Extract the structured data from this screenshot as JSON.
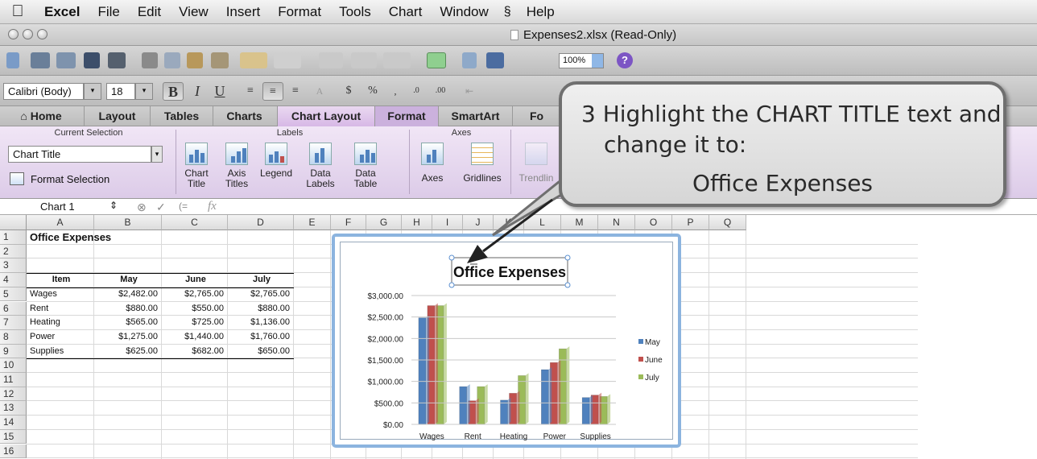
{
  "menubar": {
    "app": "Excel",
    "items": [
      "File",
      "Edit",
      "View",
      "Insert",
      "Format",
      "Tools",
      "Chart",
      "Window",
      "Help"
    ]
  },
  "window": {
    "title": "Expenses2.xlsx  (Read-Only)"
  },
  "toolbar": {
    "zoom": "100%"
  },
  "format_bar": {
    "font": "Calibri (Body)",
    "size": "18"
  },
  "ribbon": {
    "tabs": [
      "Home",
      "Layout",
      "Tables",
      "Charts",
      "Chart Layout",
      "Format",
      "SmartArt",
      "Fo"
    ],
    "active_tab": "Chart Layout",
    "groups": {
      "current_selection": "Current Selection",
      "labels": "Labels",
      "axes": "Axes"
    },
    "current_selection_value": "Chart Title",
    "format_selection": "Format Selection",
    "buttons": {
      "chart_title": [
        "Chart",
        "Title"
      ],
      "axis_titles": [
        "Axis",
        "Titles"
      ],
      "legend": "Legend",
      "data_labels": [
        "Data",
        "Labels"
      ],
      "data_table": [
        "Data",
        "Table"
      ],
      "axes": "Axes",
      "gridlines": "Gridlines",
      "trendline": "Trendlin"
    }
  },
  "formula_bar": {
    "name_box": "Chart 1",
    "fx": "fx"
  },
  "sheet": {
    "columns": [
      "A",
      "B",
      "C",
      "D",
      "E",
      "F",
      "G",
      "H",
      "I",
      "J",
      "K",
      "L",
      "M",
      "N",
      "O",
      "P",
      "Q"
    ],
    "rows": [
      "1",
      "2",
      "3",
      "4",
      "5",
      "6",
      "7",
      "8",
      "9",
      "10",
      "11",
      "12",
      "13",
      "14",
      "15",
      "16"
    ],
    "title": "Office Expenses",
    "headers": [
      "Item",
      "May",
      "June",
      "July"
    ],
    "data": [
      [
        "Wages",
        "$2,482.00",
        "$2,765.00",
        "$2,765.00"
      ],
      [
        "Rent",
        "$880.00",
        "$550.00",
        "$880.00"
      ],
      [
        "Heating",
        "$565.00",
        "$725.00",
        "$1,136.00"
      ],
      [
        "Power",
        "$1,275.00",
        "$1,440.00",
        "$1,760.00"
      ],
      [
        "Supplies",
        "$625.00",
        "$682.00",
        "$650.00"
      ]
    ]
  },
  "chart_data": {
    "type": "bar",
    "title": "Office Expenses",
    "categories": [
      "Wages",
      "Rent",
      "Heating",
      "Power",
      "Supplies"
    ],
    "series": [
      {
        "name": "May",
        "values": [
          2482,
          880,
          565,
          1275,
          625
        ],
        "color": "#4f81bd"
      },
      {
        "name": "June",
        "values": [
          2765,
          550,
          725,
          1440,
          682
        ],
        "color": "#c0504d"
      },
      {
        "name": "July",
        "values": [
          2765,
          880,
          1136,
          1760,
          650
        ],
        "color": "#9bbb59"
      }
    ],
    "yticks": [
      "$0.00",
      "$500.00",
      "$1,000.00",
      "$1,500.00",
      "$2,000.00",
      "$2,500.00",
      "$3,000.00"
    ],
    "ylim": [
      0,
      3000
    ],
    "legend": "right",
    "grid": true
  },
  "callout": {
    "line1": "3  Highlight the CHART TITLE text and",
    "line2": "change it to:",
    "line3": "Office Expenses"
  }
}
